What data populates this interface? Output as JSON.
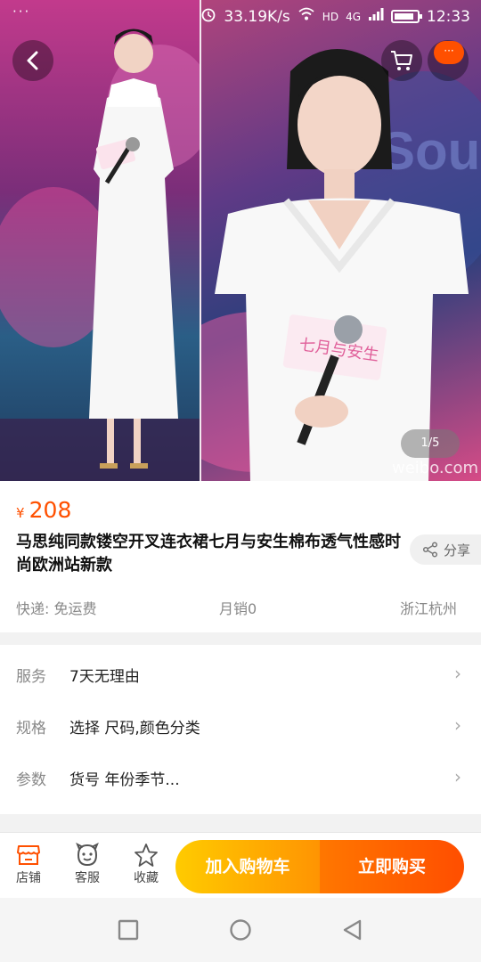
{
  "status": {
    "dots": "···",
    "speed": "33.19K/s",
    "network": "HD",
    "signal": "4G",
    "time": "12:33",
    "battery_level": 0.75
  },
  "gallery": {
    "pager": "1/5",
    "watermark": "weibo.com",
    "more_badge": "···"
  },
  "product": {
    "currency": "¥",
    "price": "208",
    "title": "马思纯同款镂空开叉连衣裙七月与安生棉布透气性感时尚欧洲站新款",
    "share_label": "分享",
    "shipping": "快递: 免运费",
    "monthly_sales": "月销0",
    "location": "浙江杭州"
  },
  "service": [
    {
      "label": "服务",
      "value": "7天无理由"
    },
    {
      "label": "规格",
      "value": "选择 尺码,颜色分类"
    },
    {
      "label": "参数",
      "value": "货号 年份季节..."
    }
  ],
  "actions": {
    "shop": "店铺",
    "support": "客服",
    "favorite": "收藏",
    "add_to_cart": "加入购物车",
    "buy_now": "立即购买"
  },
  "colors": {
    "accent": "#ff5000",
    "cart_gradient": [
      "#ffcb00",
      "#ff9402"
    ],
    "buy_gradient": [
      "#ff7700",
      "#ff4e00"
    ]
  }
}
